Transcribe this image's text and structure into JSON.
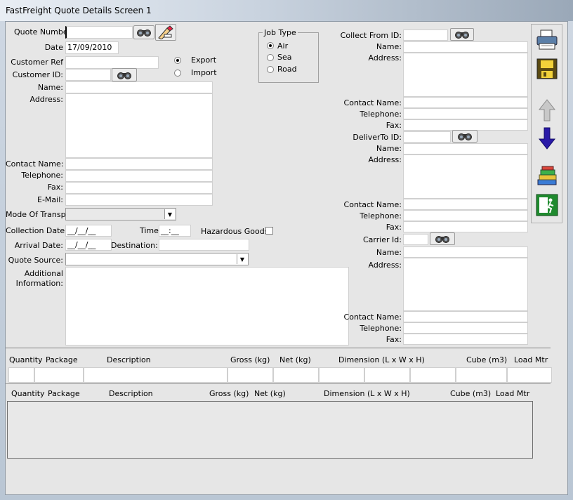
{
  "window": {
    "title": "FastFreight Quote Details   Screen 1"
  },
  "left": {
    "quote_number_label": "Quote Number",
    "quote_number_value": "",
    "date_label": "Date",
    "date_value": "17/09/2010",
    "customer_ref_label": "Customer Ref",
    "customer_ref_value": "",
    "customer_id_label": "Customer ID:",
    "name_label": "Name:",
    "address_label": "Address:",
    "contact_name_label": "Contact Name:",
    "telephone_label": "Telephone:",
    "fax_label": "Fax:",
    "email_label": "E-Mail:",
    "mode_label": "Mode Of Transpt:",
    "collection_date_label": "Collection Date:",
    "collection_date_value": "__/__/__",
    "time_label": "Time:",
    "time_value": "__:__",
    "hazardous_label": "Hazardous Goods",
    "arrival_date_label": "Arrival Date:",
    "arrival_date_value": "__/__/__",
    "destination_label": "Destination:",
    "quote_source_label": "Quote Source:",
    "additional_label_1": "Additional",
    "additional_label_2": "Information:"
  },
  "direction": {
    "export_label": "Export",
    "import_label": "Import",
    "selected": "Export"
  },
  "job_type": {
    "title": "Job Type",
    "options": [
      "Air",
      "Sea",
      "Road"
    ],
    "selected": "Air"
  },
  "collect": {
    "id_label": "Collect From ID:",
    "name_label": "Name:",
    "address_label": "Address:",
    "contact_label": "Contact Name:",
    "telephone_label": "Telephone:",
    "fax_label": "Fax:"
  },
  "deliver": {
    "id_label": "DeliverTo ID:",
    "name_label": "Name:",
    "address_label": "Address:",
    "contact_label": "Contact Name:",
    "telephone_label": "Telephone:",
    "fax_label": "Fax:"
  },
  "carrier": {
    "id_label": "Carrier Id:",
    "name_label": "Name:",
    "address_label": "Address:",
    "contact_label": "Contact Name:",
    "telephone_label": "Telephone:",
    "fax_label": "Fax:"
  },
  "entry_grid": {
    "headers": [
      "Quantity",
      "Package",
      "Description",
      "Gross (kg)",
      "Net (kg)",
      "Dimension (L x W x H)",
      "Cube (m3)",
      "Load Mtr"
    ]
  },
  "items_grid": {
    "headers": [
      "Quantity",
      "Package",
      "Description",
      "Gross (kg)",
      "Net (kg)",
      "Dimension (L x W x H)",
      "Cube (m3)",
      "Load Mtr"
    ]
  },
  "sidebar": {
    "buttons": [
      "printer-icon",
      "save-icon",
      "up-arrow-icon",
      "down-arrow-icon",
      "books-icon",
      "exit-icon"
    ]
  }
}
